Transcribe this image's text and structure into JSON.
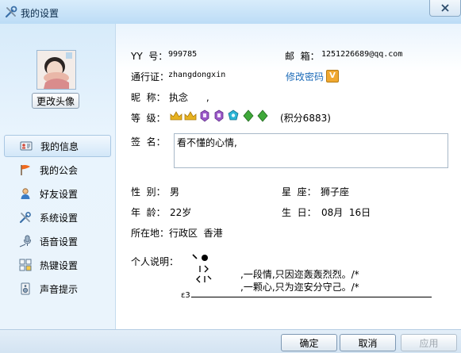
{
  "window": {
    "title": "我的设置"
  },
  "sidebar": {
    "change_avatar": "更改头像",
    "items": [
      {
        "label": "我的信息",
        "icon": "id-card-icon"
      },
      {
        "label": "我的公会",
        "icon": "flag-icon"
      },
      {
        "label": "好友设置",
        "icon": "person-icon"
      },
      {
        "label": "系统设置",
        "icon": "tools-icon"
      },
      {
        "label": "语音设置",
        "icon": "microphone-icon"
      },
      {
        "label": "热键设置",
        "icon": "keyboard-icon"
      },
      {
        "label": "声音提示",
        "icon": "speaker-icon"
      }
    ]
  },
  "profile": {
    "yy_label": "YY  号：",
    "yy_value": "999785",
    "email_label": "邮  箱：",
    "email_value": "1251226689@qq.com",
    "passport_label": "通行证：",
    "passport_value": "zhangdongxin",
    "change_password": "修改密码",
    "vip_badge": "V",
    "nickname_label": "昵  称：",
    "nickname_value": "执念      ,",
    "level_label": "等  级：",
    "level_points": "(积分6883)",
    "signature_label": "签  名：",
    "signature_value": "看不懂的心情,",
    "gender_label": "性  别：",
    "gender_value": "男",
    "constellation_label": "星  座：",
    "constellation_value": "狮子座",
    "age_label": "年  龄：",
    "age_value": "22岁",
    "birthday_label": "生  日：",
    "birthday_value": "08月  16日",
    "location_label": "所在地：",
    "location_value": "行政区  香港",
    "bio_label": "个人说明：",
    "bio_line1": ",一段情,只因迩轰轰烈烈。/*",
    "bio_line2": ",一颗心,只为迩安分守己。/*",
    "bio_mark": "ε3"
  },
  "buttons": {
    "ok": "确定",
    "cancel": "取消",
    "apply": "应用"
  },
  "colors": {
    "link": "#1c6bb8",
    "crown": "#e7b21f",
    "gem_purple": "#9b59c8",
    "gem_cyan": "#2ab4d6",
    "gem_green": "#3fa83a"
  }
}
